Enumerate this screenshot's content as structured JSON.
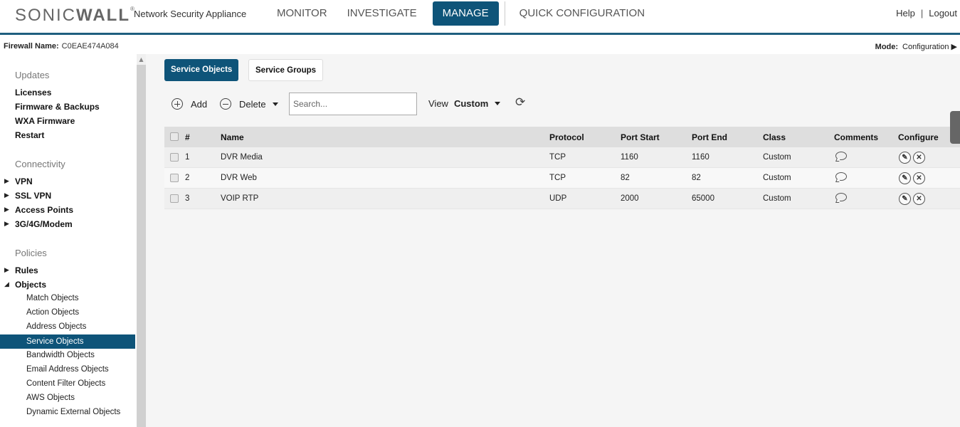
{
  "header": {
    "logo_prefix": "SONIC",
    "logo_suffix": "WALL",
    "app_name": "Network Security Appliance",
    "nav": [
      "MONITOR",
      "INVESTIGATE",
      "MANAGE",
      "QUICK CONFIGURATION"
    ],
    "active_nav": "MANAGE",
    "help": "Help",
    "separator": "|",
    "logout": "Logout"
  },
  "info": {
    "fw_label": "Firewall Name:",
    "fw_name": "C0EAE474A084",
    "mode_label": "Mode:",
    "mode_value": "Configuration ▶"
  },
  "sidebar": {
    "updates_head": "Updates",
    "updates": [
      "Licenses",
      "Firmware & Backups",
      "WXA Firmware",
      "Restart"
    ],
    "connectivity_head": "Connectivity",
    "connectivity": [
      "VPN",
      "SSL VPN",
      "Access Points",
      "3G/4G/Modem"
    ],
    "policies_head": "Policies",
    "rules": "Rules",
    "objects": "Objects",
    "object_items": [
      "Match Objects",
      "Action Objects",
      "Address Objects",
      "Service Objects",
      "Bandwidth Objects",
      "Email Address Objects",
      "Content Filter Objects",
      "AWS Objects",
      "Dynamic External Objects"
    ],
    "active_item": "Service Objects"
  },
  "tabs": {
    "service_objects": "Service Objects",
    "service_groups": "Service Groups"
  },
  "toolbar": {
    "add": "Add",
    "delete": "Delete",
    "search_placeholder": "Search...",
    "view_label": "View",
    "view_value": "Custom"
  },
  "table": {
    "headers": {
      "num": "#",
      "name": "Name",
      "protocol": "Protocol",
      "port_start": "Port Start",
      "port_end": "Port End",
      "class": "Class",
      "comments": "Comments",
      "configure": "Configure"
    },
    "rows": [
      {
        "num": "1",
        "name": "DVR Media",
        "protocol": "TCP",
        "port_start": "1160",
        "port_end": "1160",
        "class": "Custom"
      },
      {
        "num": "2",
        "name": "DVR Web",
        "protocol": "TCP",
        "port_start": "82",
        "port_end": "82",
        "class": "Custom"
      },
      {
        "num": "3",
        "name": "VOIP RTP",
        "protocol": "UDP",
        "port_start": "2000",
        "port_end": "65000",
        "class": "Custom"
      }
    ]
  },
  "colors": {
    "brand": "#0e5479",
    "header_rule": "#1f5f7f"
  }
}
